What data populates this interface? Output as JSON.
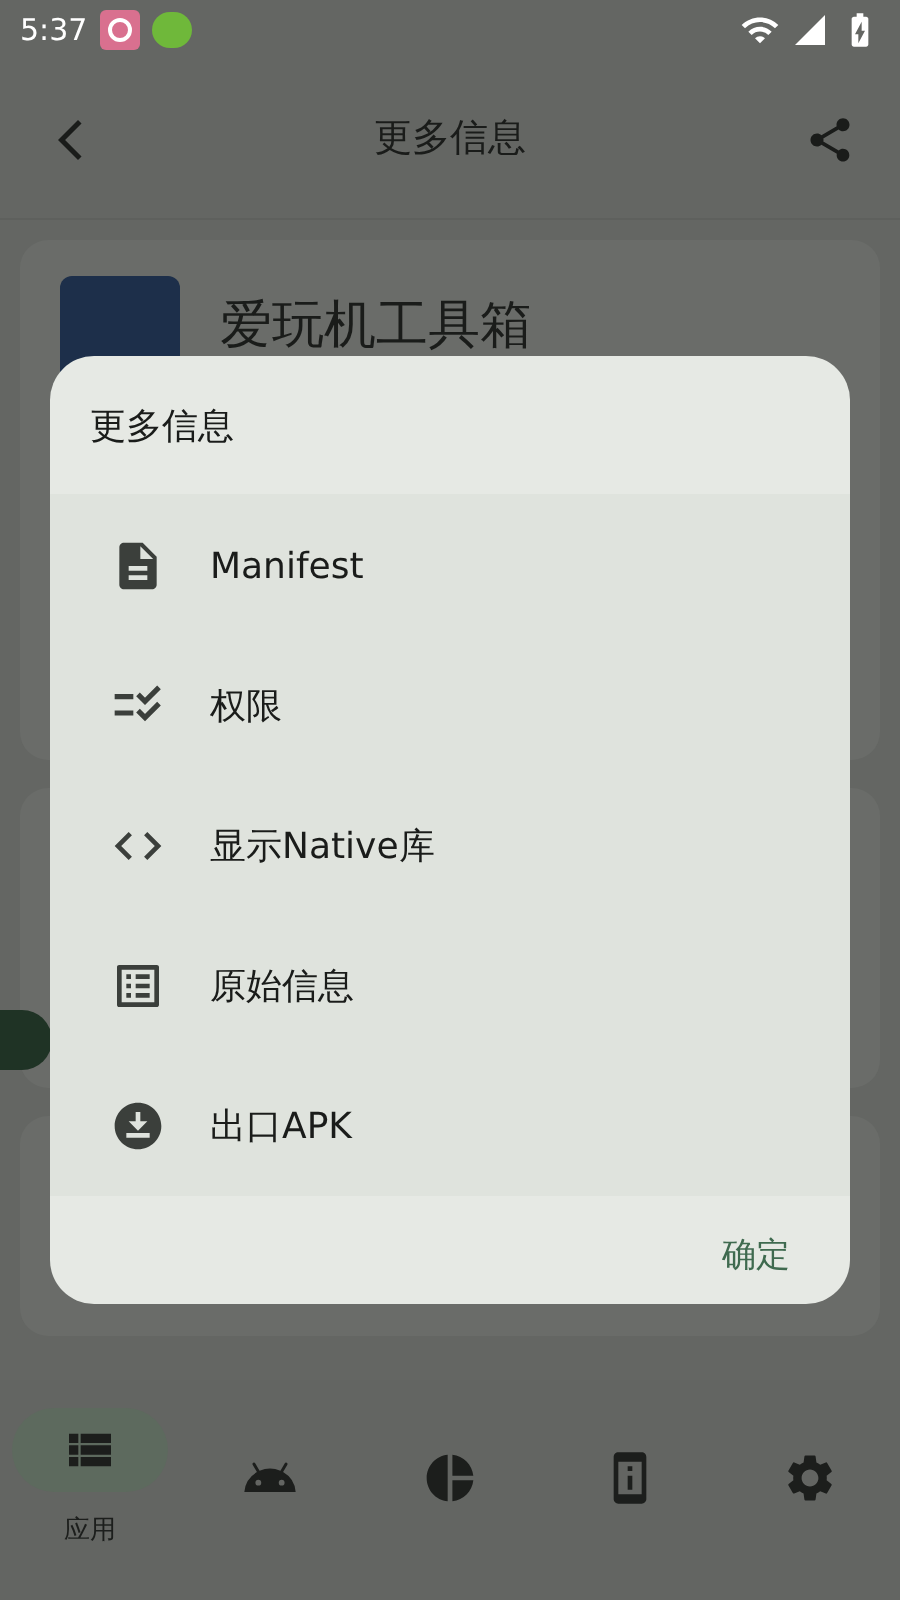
{
  "status_bar": {
    "time": "5:37"
  },
  "app_bar": {
    "title": "更多信息"
  },
  "app_card": {
    "name": "爱玩机工具箱"
  },
  "dialog": {
    "title": "更多信息",
    "items": [
      {
        "kind": "document",
        "label": "Manifest"
      },
      {
        "kind": "checklist",
        "label": "权限"
      },
      {
        "kind": "code",
        "label": "显示Native库"
      },
      {
        "kind": "list",
        "label": "原始信息"
      },
      {
        "kind": "download",
        "label": "出口APK"
      }
    ],
    "confirm": "确定"
  },
  "bottom_nav": [
    {
      "kind": "apps",
      "selected": true,
      "label": "应用"
    },
    {
      "kind": "android",
      "selected": false
    },
    {
      "kind": "chart",
      "selected": false
    },
    {
      "kind": "device",
      "selected": false
    },
    {
      "kind": "settings",
      "selected": false
    }
  ]
}
